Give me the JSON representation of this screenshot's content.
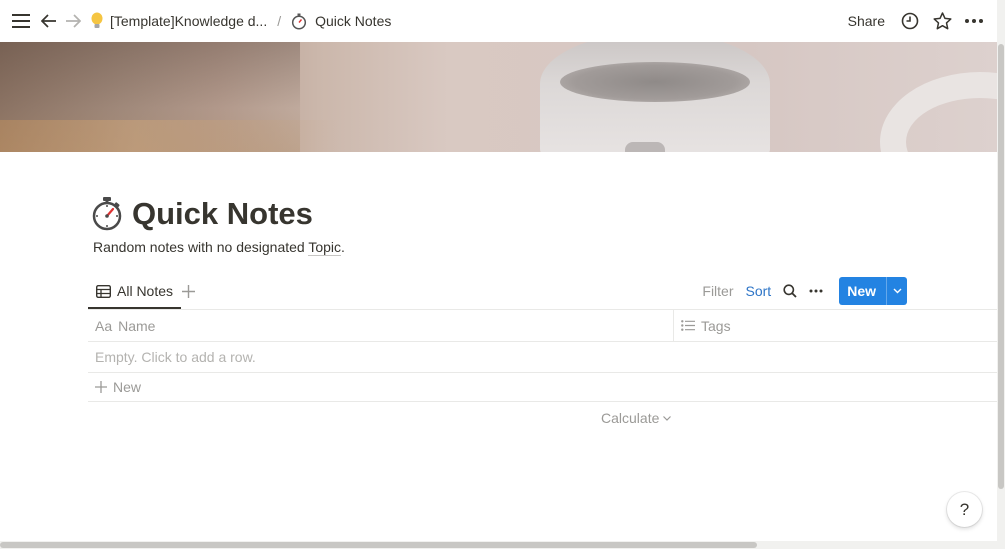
{
  "topbar": {
    "breadcrumb_parent": "[Template]Knowledge d...",
    "breadcrumb_separator": "/",
    "breadcrumb_current": "Quick Notes",
    "share_label": "Share"
  },
  "page": {
    "title": "Quick Notes",
    "description_prefix": "Random notes with no designated ",
    "description_link": "Topic",
    "description_suffix": "."
  },
  "views": {
    "active_tab": "All Notes",
    "filter_label": "Filter",
    "sort_label": "Sort",
    "new_label": "New"
  },
  "table": {
    "columns": [
      {
        "icon": "Aa",
        "label": "Name"
      },
      {
        "icon": "list-icon",
        "label": "Tags"
      }
    ],
    "empty_text": "Empty. Click to add a row.",
    "new_row_label": "New",
    "calculate_label": "Calculate"
  },
  "help": {
    "label": "?"
  },
  "colors": {
    "accent": "#2383e2",
    "sort_link": "#2e75c7",
    "text": "#37352f",
    "muted": "#9b9a97"
  }
}
